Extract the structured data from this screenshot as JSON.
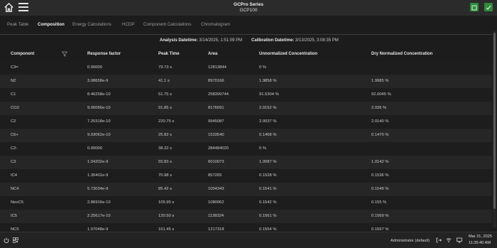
{
  "header": {
    "title": "GCPro Series",
    "subtitle": "GCP100"
  },
  "tabs": [
    {
      "label": "Peak Table"
    },
    {
      "label": "Composition"
    },
    {
      "label": "Energy Calculations"
    },
    {
      "label": "HCDP"
    },
    {
      "label": "Component Calculations"
    },
    {
      "label": "Chromatogram"
    }
  ],
  "active_tab": "Composition",
  "info": {
    "analysis_label": "Analysis Datetime:",
    "analysis_value": "3/14/2025, 1:51:09 PM",
    "calibration_label": "Calibration Datetime:",
    "calibration_value": "3/13/2025, 3:08:35 PM"
  },
  "table": {
    "headers": [
      "Component",
      "Response factor",
      "Peak Time",
      "Area",
      "Unnormalized Concentration",
      "Dry Normalized Concentration"
    ],
    "rows": [
      [
        "C3=",
        "0.00000",
        "79.73 s",
        "12813844",
        "0 %",
        ""
      ],
      [
        "N2",
        "3.08658e-9",
        "41.1 s",
        "8970166",
        "1.9858 %",
        "1.9985 %"
      ],
      [
        "C1",
        "8.46258e-10",
        "51.75 s",
        "258399744",
        "91.5304 %",
        "92.0045 %"
      ],
      [
        "CO2",
        "9.06066e-10",
        "91.85 s",
        "8176091",
        "2.0152 %",
        "2.026 %"
      ],
      [
        "C2",
        "7.20318e-10",
        "220.75 s",
        "9945087",
        "2.0037 %",
        "2.0140 %"
      ],
      [
        "C6+",
        "9.93062e-10",
        "25.82 s",
        "1533540",
        "0.1468 %",
        "0.1470 %"
      ],
      [
        "C2-",
        "0.00000",
        "38.32 s",
        "284484020",
        "0 %",
        ""
      ],
      [
        "C3",
        "1.04202e-9",
        "55.83 s",
        "6010073",
        "1.0087 %",
        "1.0142 %"
      ],
      [
        "IC4",
        "1.30401e-9",
        "70.98 s",
        "857265",
        "0.1528 %",
        "0.1536 %"
      ],
      [
        "NC4",
        "5.73034e-9",
        "85.42 s",
        "1004343",
        "0.1541 %",
        "0.1549 %"
      ],
      [
        "NeoC5",
        "2.86916e-10",
        "105.95 s",
        "1080062",
        "0.1542 %",
        "0.155 %"
      ],
      [
        "IC5",
        "2.25617e-10",
        "120.50 s",
        "1138324",
        "0.1561 %",
        "0.1569 %"
      ],
      [
        "NC5",
        "1.07048e-9",
        "161.45 s",
        "1217318",
        "0.1554 %",
        "0.1567 %"
      ]
    ]
  },
  "footer": {
    "user": "Administrator (default)",
    "date": "Mar 21, 2025",
    "time": "11:35:40 AM"
  },
  "colors": {
    "background": "#1c1c1c",
    "header_bg": "#2b2b2b",
    "accent_green": "#2f8a3c"
  }
}
